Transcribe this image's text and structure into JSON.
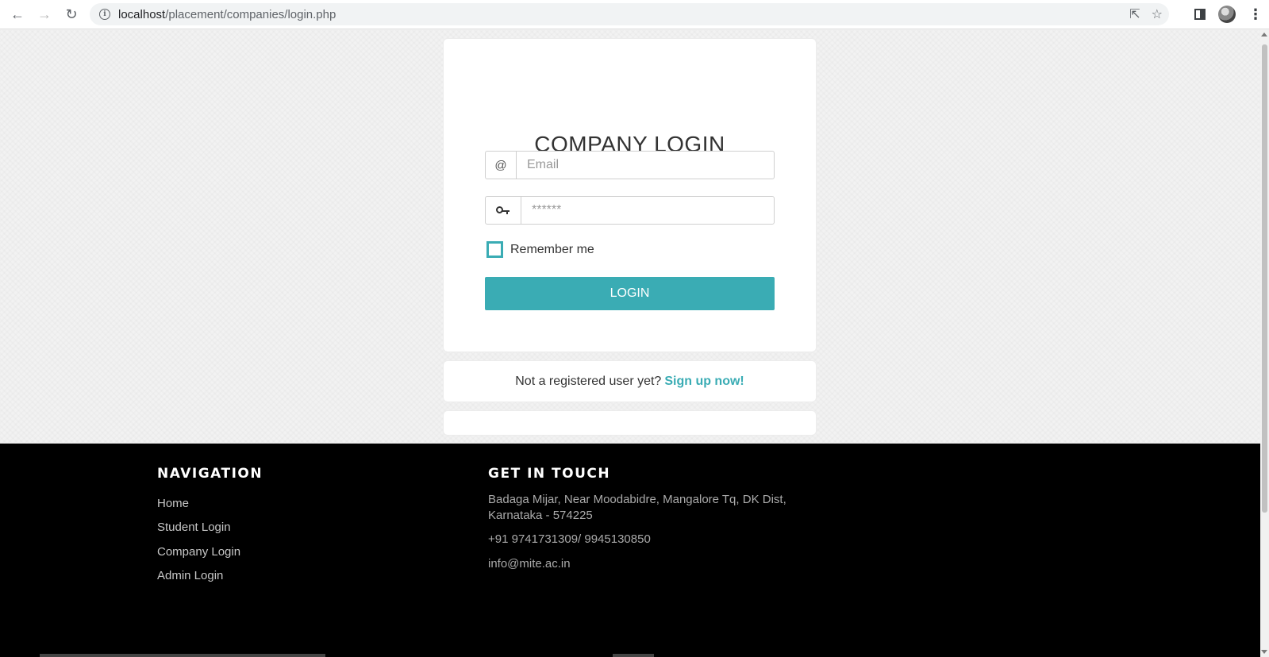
{
  "browser": {
    "url_host": "localhost",
    "url_path": "/placement/companies/login.php",
    "icons": [
      "back-arrow-icon",
      "forward-arrow-icon",
      "reload-icon",
      "info-icon",
      "share-icon",
      "star-icon",
      "sidebar-icon",
      "profile-avatar",
      "kebab-menu-icon"
    ]
  },
  "login": {
    "title": "COMPANY LOGIN",
    "email_addon": "@",
    "email_placeholder": "Email",
    "password_placeholder": "******",
    "remember_label": "Remember me",
    "remember_checked": false,
    "login_button": "LOGIN"
  },
  "signup": {
    "prompt": "Not a registered user yet?",
    "link": "Sign up now!"
  },
  "footer": {
    "navigation": {
      "heading": "NAVIGATION",
      "links": [
        "Home",
        "Student Login",
        "Company Login",
        "Admin Login"
      ]
    },
    "contact": {
      "heading": "GET IN TOUCH",
      "address_line1": "Badaga Mijar, Near Moodabidre, Mangalore Tq, DK Dist,",
      "address_line2": "Karnataka - 574225",
      "phone": "+91 9741731309/ 9945130850",
      "email": "info@mite.ac.in"
    }
  },
  "colors": {
    "accent": "#3aacb4",
    "footer_bg": "#000000",
    "page_bg": "#f2f2f2"
  }
}
